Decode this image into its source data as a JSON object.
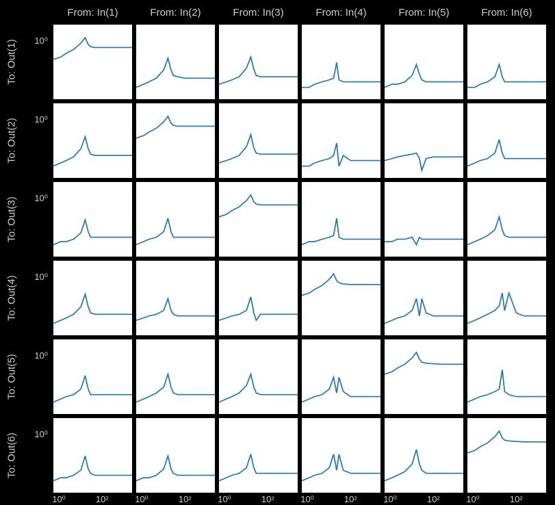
{
  "colors": {
    "line": "#1f77b4",
    "fg": "#cccccc",
    "bg": "#000000",
    "panel": "#ffffff"
  },
  "col_labels": [
    "From: In(1)",
    "From: In(2)",
    "From: In(3)",
    "From: In(4)",
    "From: In(5)",
    "From: In(6)"
  ],
  "row_labels": [
    "To: Out(1)",
    "To: Out(2)",
    "To: Out(3)",
    "To: Out(4)",
    "To: Out(5)",
    "To: Out(6)"
  ],
  "y_tick_label": "10⁰",
  "x_tick_labels": [
    "10⁰",
    "10²"
  ],
  "chart_data": {
    "type": "line",
    "description": "6×6 grid of log-log magnitude plots (frequency response / sigma-style). Each subplot shows magnitude vs frequency. Diagonal plots have higher steady magnitude (≈1–2); off-diagonal plots have low baseline (≈0.05–0.1) with one or two narrow resonant peaks near freq ≈5–10.",
    "xlabel": "",
    "ylabel": "",
    "xscale": "log",
    "yscale": "log",
    "xlim": [
      0.3,
      500
    ],
    "ylim": [
      0.01,
      10
    ],
    "rows": 6,
    "cols": 6,
    "shared_x": [
      0.3,
      0.6,
      1,
      2,
      4,
      6,
      8,
      10,
      15,
      30,
      60,
      120,
      250,
      500
    ],
    "panels": [
      [
        {
          "y": [
            0.4,
            0.5,
            0.7,
            1.0,
            1.8,
            3.0,
            1.6,
            1.3,
            1.2,
            1.2,
            1.2,
            1.2,
            1.2,
            1.2
          ]
        },
        {
          "y": [
            0.03,
            0.04,
            0.05,
            0.07,
            0.15,
            0.45,
            0.15,
            0.09,
            0.08,
            0.07,
            0.07,
            0.07,
            0.07,
            0.07
          ]
        },
        {
          "y": [
            0.04,
            0.05,
            0.06,
            0.08,
            0.18,
            0.5,
            0.16,
            0.09,
            0.08,
            0.08,
            0.08,
            0.08,
            0.08,
            0.08
          ]
        },
        {
          "y": [
            0.03,
            0.03,
            0.04,
            0.05,
            0.06,
            0.07,
            0.3,
            0.06,
            0.05,
            0.05,
            0.05,
            0.05,
            0.05,
            0.05
          ]
        },
        {
          "y": [
            0.03,
            0.04,
            0.04,
            0.05,
            0.09,
            0.25,
            0.1,
            0.06,
            0.05,
            0.05,
            0.05,
            0.05,
            0.05,
            0.05
          ]
        },
        {
          "y": [
            0.03,
            0.03,
            0.04,
            0.05,
            0.08,
            0.25,
            0.08,
            0.05,
            0.05,
            0.05,
            0.05,
            0.05,
            0.05,
            0.05
          ]
        }
      ],
      [
        {
          "y": [
            0.03,
            0.04,
            0.05,
            0.07,
            0.15,
            0.45,
            0.15,
            0.09,
            0.08,
            0.08,
            0.08,
            0.08,
            0.08,
            0.08
          ]
        },
        {
          "y": [
            0.4,
            0.5,
            0.7,
            1.0,
            1.8,
            3.0,
            1.6,
            1.3,
            1.2,
            1.2,
            1.2,
            1.2,
            1.2,
            1.2
          ]
        },
        {
          "y": [
            0.04,
            0.05,
            0.06,
            0.08,
            0.18,
            0.55,
            0.16,
            0.1,
            0.09,
            0.09,
            0.09,
            0.09,
            0.09,
            0.09
          ]
        },
        {
          "y": [
            0.03,
            0.03,
            0.04,
            0.05,
            0.06,
            0.08,
            0.25,
            0.03,
            0.08,
            0.05,
            0.05,
            0.05,
            0.05,
            0.05
          ]
        },
        {
          "y": [
            0.05,
            0.06,
            0.07,
            0.08,
            0.09,
            0.1,
            0.06,
            0.02,
            0.06,
            0.07,
            0.07,
            0.07,
            0.07,
            0.07
          ]
        },
        {
          "y": [
            0.03,
            0.04,
            0.05,
            0.06,
            0.1,
            0.35,
            0.1,
            0.06,
            0.06,
            0.06,
            0.06,
            0.06,
            0.06,
            0.06
          ]
        }
      ],
      [
        {
          "y": [
            0.03,
            0.04,
            0.04,
            0.05,
            0.09,
            0.3,
            0.1,
            0.06,
            0.06,
            0.06,
            0.06,
            0.06,
            0.06,
            0.06
          ]
        },
        {
          "y": [
            0.03,
            0.04,
            0.05,
            0.06,
            0.1,
            0.35,
            0.1,
            0.06,
            0.06,
            0.06,
            0.06,
            0.06,
            0.06,
            0.06
          ]
        },
        {
          "y": [
            0.4,
            0.5,
            0.7,
            1.0,
            1.8,
            3.0,
            1.6,
            1.3,
            1.2,
            1.2,
            1.2,
            1.2,
            1.2,
            1.2
          ]
        },
        {
          "y": [
            0.03,
            0.04,
            0.04,
            0.05,
            0.06,
            0.07,
            0.35,
            0.06,
            0.05,
            0.05,
            0.05,
            0.05,
            0.05,
            0.05
          ]
        },
        {
          "y": [
            0.04,
            0.04,
            0.05,
            0.05,
            0.06,
            0.03,
            0.06,
            0.05,
            0.05,
            0.05,
            0.05,
            0.05,
            0.05,
            0.05
          ]
        },
        {
          "y": [
            0.03,
            0.04,
            0.05,
            0.07,
            0.12,
            0.4,
            0.12,
            0.07,
            0.06,
            0.06,
            0.06,
            0.06,
            0.06,
            0.06
          ]
        }
      ],
      [
        {
          "y": [
            0.03,
            0.04,
            0.05,
            0.07,
            0.14,
            0.45,
            0.14,
            0.08,
            0.07,
            0.07,
            0.07,
            0.07,
            0.07,
            0.07
          ]
        },
        {
          "y": [
            0.04,
            0.05,
            0.06,
            0.07,
            0.1,
            0.3,
            0.1,
            0.07,
            0.06,
            0.06,
            0.06,
            0.06,
            0.06,
            0.06
          ]
        },
        {
          "y": [
            0.04,
            0.05,
            0.06,
            0.07,
            0.1,
            0.35,
            0.08,
            0.04,
            0.07,
            0.07,
            0.07,
            0.07,
            0.07,
            0.07
          ]
        },
        {
          "y": [
            0.4,
            0.5,
            0.7,
            1.0,
            1.8,
            3.0,
            1.6,
            1.3,
            1.15,
            1.1,
            1.1,
            1.1,
            1.1,
            1.1
          ]
        },
        {
          "y": [
            0.03,
            0.04,
            0.05,
            0.06,
            0.1,
            0.3,
            0.06,
            0.3,
            0.08,
            0.06,
            0.06,
            0.06,
            0.06,
            0.06
          ]
        },
        {
          "y": [
            0.03,
            0.04,
            0.05,
            0.07,
            0.1,
            0.15,
            0.5,
            0.1,
            0.5,
            0.08,
            0.06,
            0.06,
            0.06,
            0.06
          ]
        }
      ],
      [
        {
          "y": [
            0.03,
            0.04,
            0.05,
            0.06,
            0.1,
            0.35,
            0.1,
            0.06,
            0.06,
            0.06,
            0.06,
            0.06,
            0.06,
            0.06
          ]
        },
        {
          "y": [
            0.03,
            0.04,
            0.05,
            0.07,
            0.12,
            0.4,
            0.12,
            0.07,
            0.06,
            0.06,
            0.06,
            0.06,
            0.06,
            0.06
          ]
        },
        {
          "y": [
            0.03,
            0.04,
            0.05,
            0.07,
            0.14,
            0.4,
            0.12,
            0.07,
            0.06,
            0.06,
            0.06,
            0.06,
            0.06,
            0.06
          ]
        },
        {
          "y": [
            0.03,
            0.04,
            0.05,
            0.06,
            0.1,
            0.3,
            0.07,
            0.3,
            0.08,
            0.05,
            0.05,
            0.05,
            0.05,
            0.05
          ]
        },
        {
          "y": [
            0.4,
            0.5,
            0.7,
            1.0,
            1.8,
            3.0,
            1.6,
            1.2,
            1.1,
            1.05,
            1.0,
            1.0,
            1.0,
            1.0
          ]
        },
        {
          "y": [
            0.03,
            0.04,
            0.05,
            0.06,
            0.08,
            0.1,
            0.6,
            0.08,
            0.06,
            0.05,
            0.05,
            0.05,
            0.05,
            0.05
          ]
        }
      ],
      [
        {
          "y": [
            0.03,
            0.04,
            0.04,
            0.05,
            0.08,
            0.3,
            0.09,
            0.06,
            0.05,
            0.05,
            0.05,
            0.05,
            0.05,
            0.05
          ]
        },
        {
          "y": [
            0.03,
            0.04,
            0.04,
            0.05,
            0.09,
            0.3,
            0.09,
            0.06,
            0.05,
            0.05,
            0.05,
            0.05,
            0.05,
            0.05
          ]
        },
        {
          "y": [
            0.03,
            0.04,
            0.05,
            0.06,
            0.1,
            0.35,
            0.1,
            0.06,
            0.06,
            0.06,
            0.06,
            0.06,
            0.06,
            0.06
          ]
        },
        {
          "y": [
            0.03,
            0.04,
            0.05,
            0.06,
            0.1,
            0.35,
            0.08,
            0.35,
            0.08,
            0.06,
            0.06,
            0.06,
            0.06,
            0.06
          ]
        },
        {
          "y": [
            0.03,
            0.04,
            0.05,
            0.07,
            0.14,
            0.55,
            0.14,
            0.08,
            0.06,
            0.06,
            0.06,
            0.06,
            0.06,
            0.06
          ]
        },
        {
          "y": [
            0.4,
            0.5,
            0.7,
            1.0,
            1.8,
            3.0,
            1.6,
            1.3,
            1.2,
            1.15,
            1.1,
            1.1,
            1.1,
            1.1
          ]
        }
      ]
    ]
  }
}
